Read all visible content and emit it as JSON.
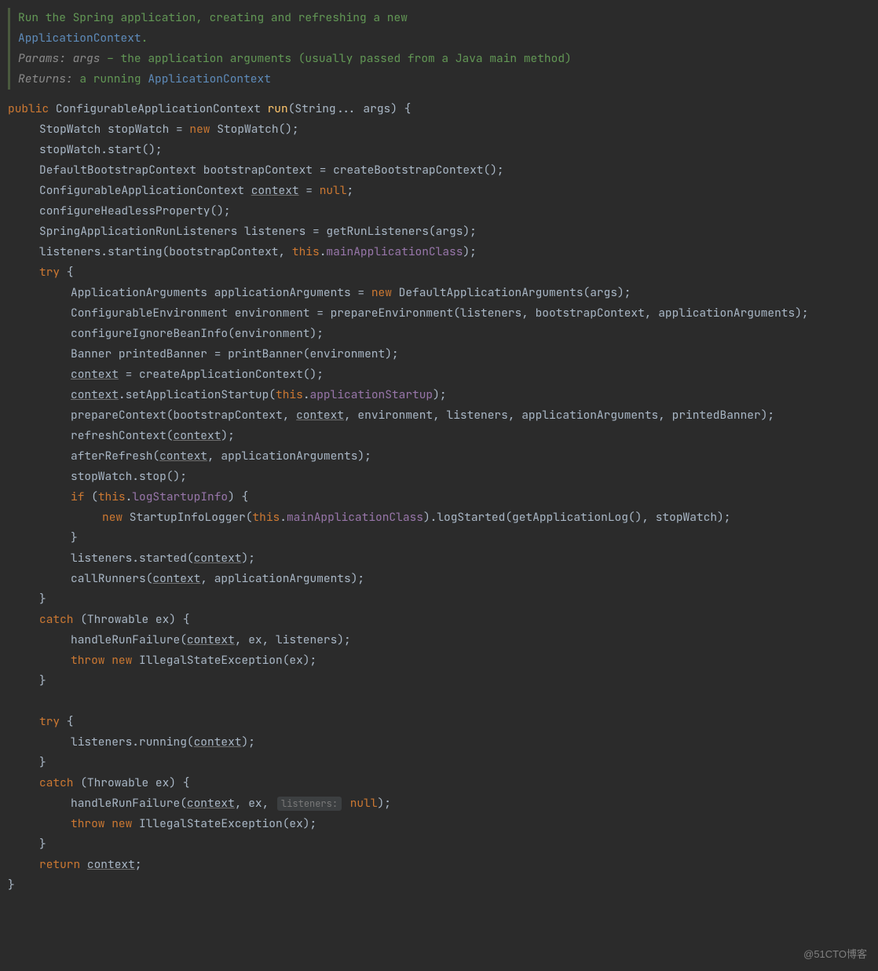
{
  "javadoc": {
    "summary_a": "Run the Spring application, creating and refreshing a new ",
    "summary_link": "ApplicationContext",
    "summary_b": ".",
    "params_label": "Params:",
    "params_name": "args",
    "params_desc": " – the application arguments (usually passed from a Java main method)",
    "returns_label": "Returns:",
    "returns_a": "a running ",
    "returns_link": "ApplicationContext"
  },
  "code": {
    "l1_public": "public",
    "l1_type": " ConfigurableApplicationContext ",
    "l1_method": "run",
    "l1_after": "(String... args) {",
    "l2_a": "StopWatch stopWatch = ",
    "l2_new": "new",
    "l2_b": " StopWatch();",
    "l3": "stopWatch.start();",
    "l4": "DefaultBootstrapContext bootstrapContext = createBootstrapContext();",
    "l5_a": "ConfigurableApplicationContext ",
    "l5_ctx": "context",
    "l5_b": " = ",
    "l5_null": "null",
    "l5_c": ";",
    "l6": "configureHeadlessProperty();",
    "l7": "SpringApplicationRunListeners listeners = getRunListeners(args);",
    "l8_a": "listeners.starting(bootstrapContext, ",
    "l8_this": "this",
    "l8_b": ".",
    "l8_field": "mainApplicationClass",
    "l8_c": ");",
    "l9_try": "try",
    "l9_b": " {",
    "l10_a": "ApplicationArguments applicationArguments = ",
    "l10_new": "new",
    "l10_b": " DefaultApplicationArguments(args);",
    "l11": "ConfigurableEnvironment environment = prepareEnvironment(listeners, bootstrapContext, applicationArguments);",
    "l12": "configureIgnoreBeanInfo(environment);",
    "l13": "Banner printedBanner = printBanner(environment);",
    "l14_ctx": "context",
    "l14_b": " = createApplicationContext();",
    "l15_ctx": "context",
    "l15_a": ".setApplicationStartup(",
    "l15_this": "this",
    "l15_b": ".",
    "l15_field": "applicationStartup",
    "l15_c": ");",
    "l16_a": "prepareContext(bootstrapContext, ",
    "l16_ctx": "context",
    "l16_b": ", environment, listeners, applicationArguments, printedBanner);",
    "l17_a": "refreshContext(",
    "l17_ctx": "context",
    "l17_b": ");",
    "l18_a": "afterRefresh(",
    "l18_ctx": "context",
    "l18_b": ", applicationArguments);",
    "l19": "stopWatch.stop();",
    "l20_if": "if",
    "l20_a": " (",
    "l20_this": "this",
    "l20_b": ".",
    "l20_field": "logStartupInfo",
    "l20_c": ") {",
    "l21_new": "new",
    "l21_a": " StartupInfoLogger(",
    "l21_this": "this",
    "l21_b": ".",
    "l21_field": "mainApplicationClass",
    "l21_c": ").logStarted(getApplicationLog(), stopWatch);",
    "l22": "}",
    "l23_a": "listeners.started(",
    "l23_ctx": "context",
    "l23_b": ");",
    "l24_a": "callRunners(",
    "l24_ctx": "context",
    "l24_b": ", applicationArguments);",
    "l25": "}",
    "l26_catch": "catch",
    "l26_a": " (Throwable ex) {",
    "l27_a": "handleRunFailure(",
    "l27_ctx": "context",
    "l27_b": ", ex, listeners);",
    "l28_throw": "throw new",
    "l28_a": " IllegalStateException(ex);",
    "l29": "}",
    "l30_try": "try",
    "l30_a": " {",
    "l31_a": "listeners.running(",
    "l31_ctx": "context",
    "l31_b": ");",
    "l32": "}",
    "l33_catch": "catch",
    "l33_a": " (Throwable ex) {",
    "l34_a": "handleRunFailure(",
    "l34_ctx": "context",
    "l34_b": ", ex, ",
    "l34_hint": "listeners:",
    "l34_null": "null",
    "l34_c": ");",
    "l35_throw": "throw new",
    "l35_a": " IllegalStateException(ex);",
    "l36": "}",
    "l37_return": "return",
    "l37_a": " ",
    "l37_ctx": "context",
    "l37_b": ";",
    "l38": "}"
  },
  "watermark": "@51CTO博客"
}
